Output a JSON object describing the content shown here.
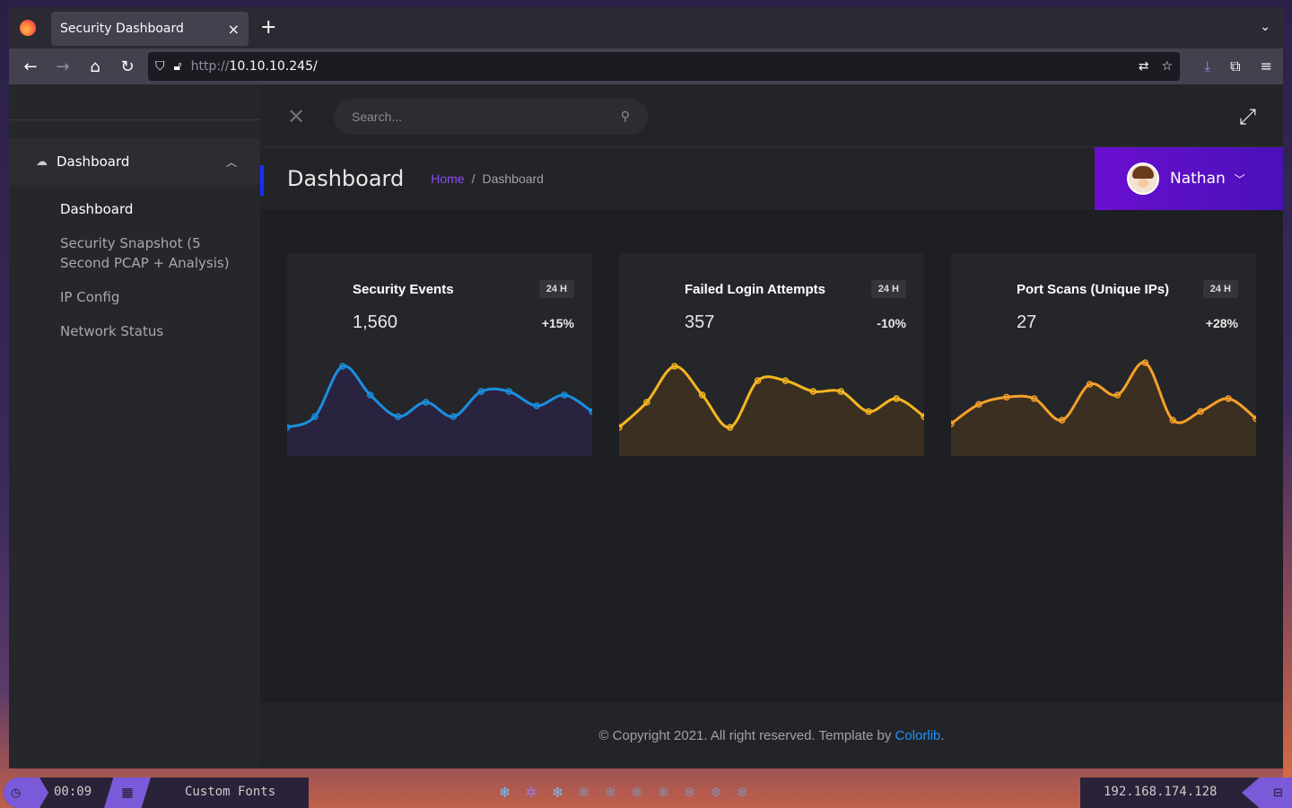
{
  "browser": {
    "tab_title": "Security Dashboard",
    "tab_close": "×",
    "new_tab": "+",
    "url_scheme": "http://",
    "url_host": "10.10.10.245/"
  },
  "sidebar": {
    "section_label": "Dashboard",
    "items": [
      {
        "label": "Dashboard",
        "active": true
      },
      {
        "label": "Security Snapshot (5 Second PCAP + Analysis)",
        "active": false
      },
      {
        "label": "IP Config",
        "active": false
      },
      {
        "label": "Network Status",
        "active": false
      }
    ]
  },
  "topbar": {
    "search_placeholder": "Search..."
  },
  "pagebar": {
    "title": "Dashboard",
    "breadcrumb_home": "Home",
    "breadcrumb_sep": "/",
    "breadcrumb_current": "Dashboard",
    "user_name": "Nathan"
  },
  "cards": [
    {
      "title": "Security Events",
      "badge": "24 H",
      "value": "1,560",
      "change": "+15%",
      "color": "#1a8fe0",
      "fill": "#2a2340",
      "points": [
        0.1,
        0.25,
        0.95,
        0.55,
        0.25,
        0.45,
        0.25,
        0.6,
        0.6,
        0.4,
        0.55,
        0.32
      ]
    },
    {
      "title": "Failed Login Attempts",
      "badge": "24 H",
      "value": "357",
      "change": "-10%",
      "color": "#f6b61e",
      "fill": "#3a2f20",
      "points": [
        0.1,
        0.45,
        0.95,
        0.55,
        0.1,
        0.75,
        0.75,
        0.6,
        0.6,
        0.32,
        0.5,
        0.25
      ]
    },
    {
      "title": "Port Scans (Unique IPs)",
      "badge": "24 H",
      "value": "27",
      "change": "+28%",
      "color": "#f6a02a",
      "fill": "#3a2f20",
      "points": [
        0.15,
        0.42,
        0.52,
        0.5,
        0.2,
        0.7,
        0.55,
        1.0,
        0.2,
        0.32,
        0.5,
        0.22
      ]
    }
  ],
  "footer": {
    "text": "© Copyright 2021. All right reserved. Template by ",
    "link": "Colorlib",
    "end": "."
  },
  "taskbar": {
    "time": "00:09",
    "fonts_label": "Custom Fonts",
    "ip": "192.168.174.128"
  }
}
